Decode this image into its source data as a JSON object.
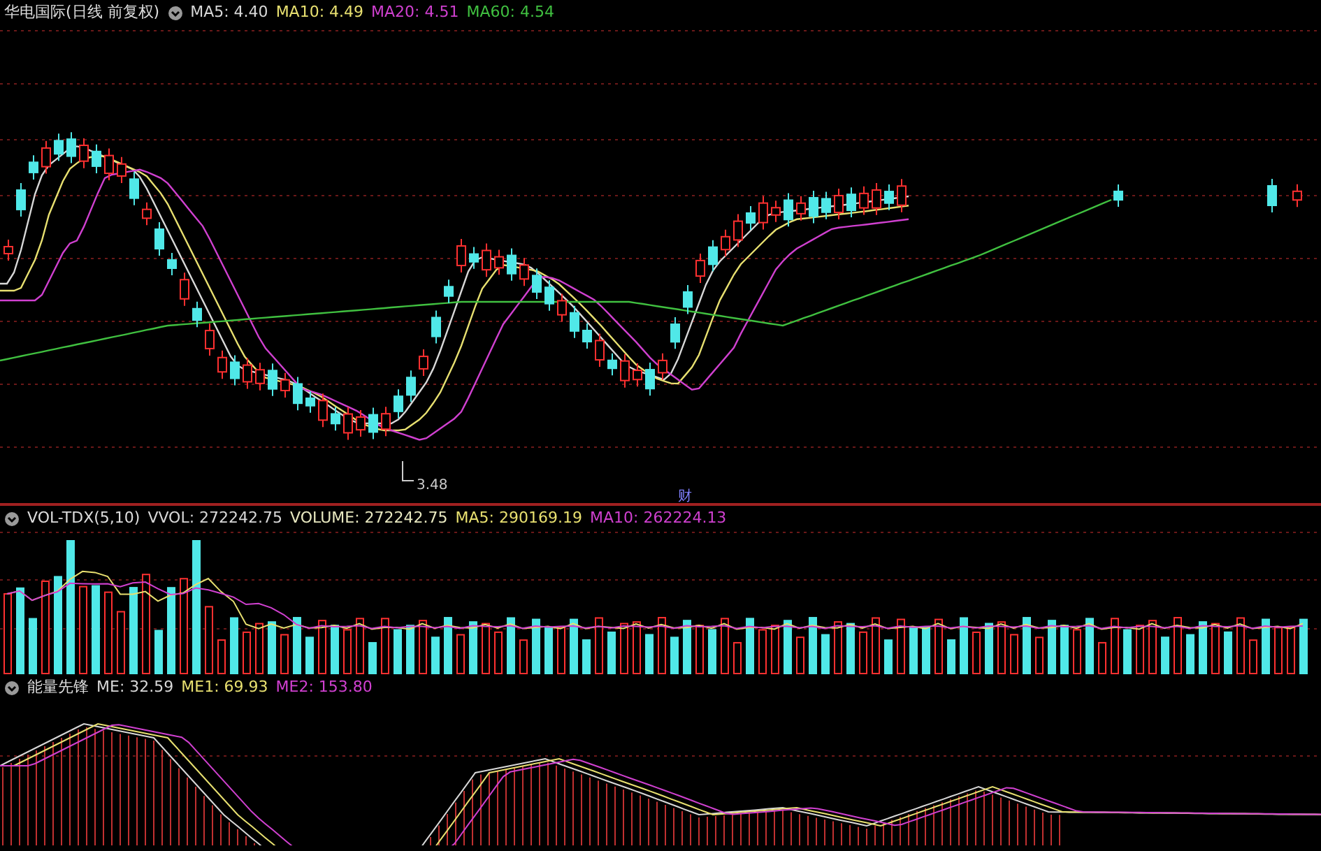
{
  "price_panel": {
    "title": "华电国际(日线 前复权)",
    "readings": [
      {
        "label": "MA5: 4.40",
        "color": "#d8d8d8"
      },
      {
        "label": "MA10: 4.49",
        "color": "#e8e070"
      },
      {
        "label": "MA20: 4.51",
        "color": "#d040d0"
      },
      {
        "label": "MA60: 4.54",
        "color": "#40c040"
      }
    ],
    "low_label": "3.48",
    "event_mark": "财"
  },
  "volume_panel": {
    "indicator_name": "VOL-TDX(5,10)",
    "readings": [
      {
        "label": "VVOL: 272242.75",
        "color": "#d8d8d8"
      },
      {
        "label": "VOLUME: 272242.75",
        "color": "#e8e8c0"
      },
      {
        "label": "MA5: 290169.19",
        "color": "#e8e070"
      },
      {
        "label": "MA10: 262224.13",
        "color": "#d040d0"
      }
    ]
  },
  "energy_panel": {
    "indicator_name": "能量先锋",
    "readings": [
      {
        "label": "ME: 32.59",
        "color": "#d8d8d8"
      },
      {
        "label": "ME1: 69.93",
        "color": "#e8e070"
      },
      {
        "label": "ME2: 153.80",
        "color": "#d040d0"
      }
    ]
  }
}
